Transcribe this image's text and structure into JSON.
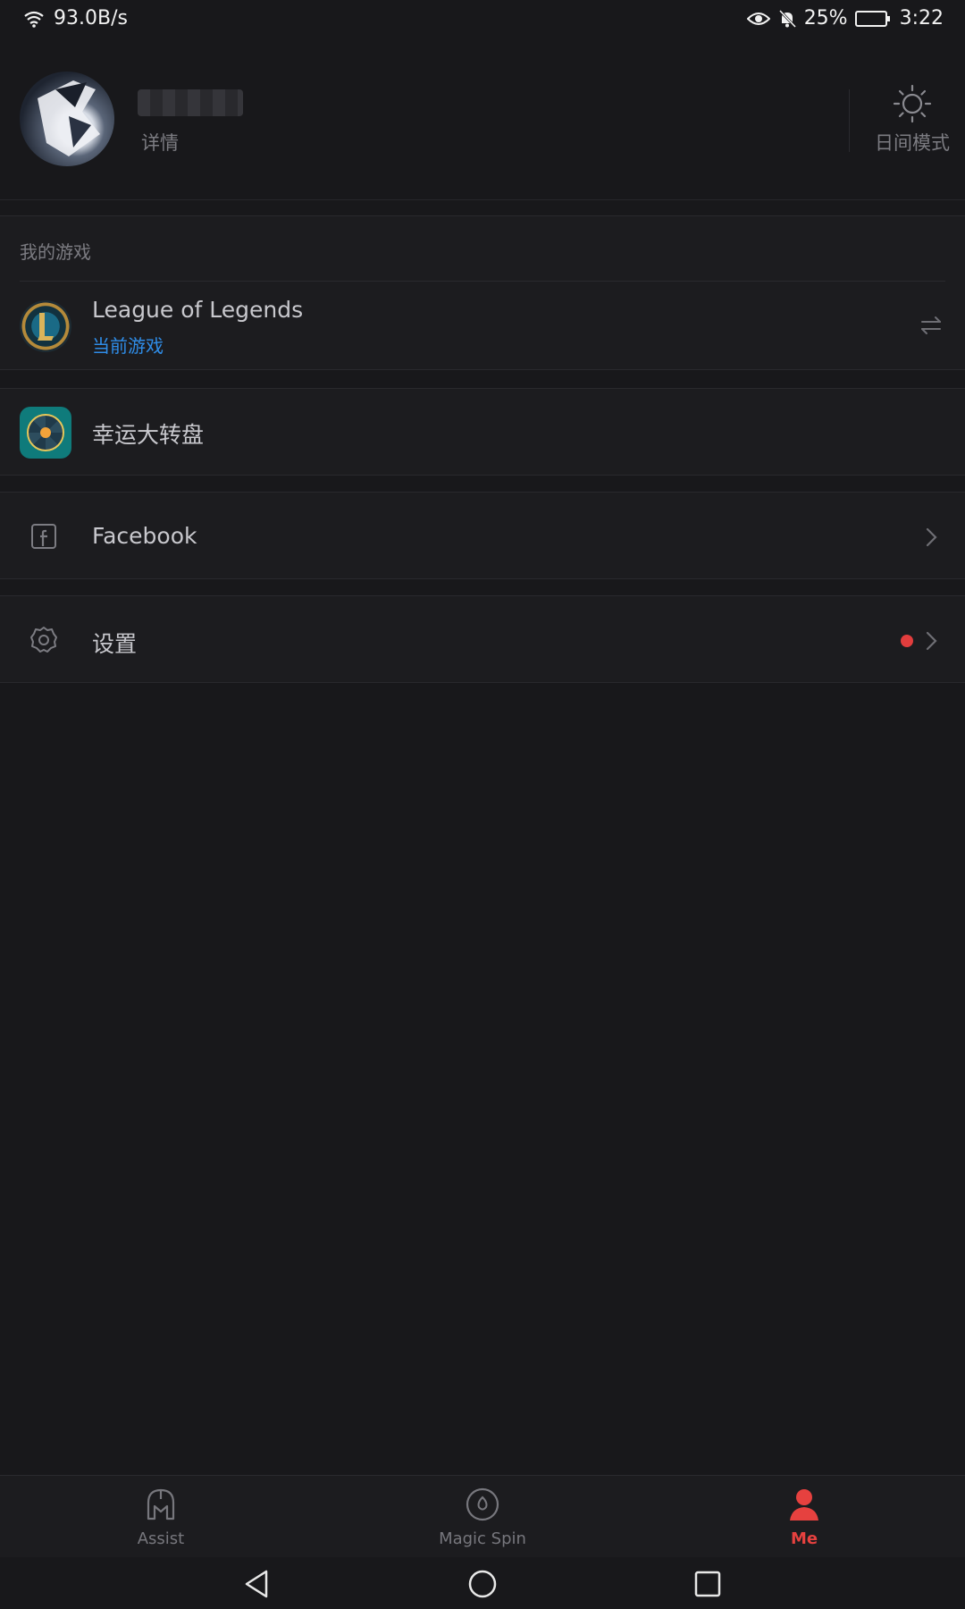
{
  "status_bar": {
    "net_speed": "93.0B/s",
    "battery_pct": "25%",
    "time": "3:22"
  },
  "profile": {
    "detail_label": "详情",
    "mode_label": "日间模式"
  },
  "my_games": {
    "section_title": "我的游戏",
    "game_name": "League of Legends",
    "current_label": "当前游戏"
  },
  "lucky_wheel": {
    "label": "幸运大转盘"
  },
  "facebook": {
    "label": "Facebook"
  },
  "settings": {
    "label": "设置",
    "has_badge": true
  },
  "bottom_nav": {
    "items": [
      {
        "label": "Assist",
        "icon": "helmet-icon",
        "active": false
      },
      {
        "label": "Magic Spin",
        "icon": "spin-icon",
        "active": false
      },
      {
        "label": "Me",
        "icon": "person-icon",
        "active": true
      }
    ]
  },
  "colors": {
    "background": "#18181b",
    "accent_red": "#e6413f",
    "link_blue": "#2f8de8",
    "badge_red": "#e23d3d"
  }
}
